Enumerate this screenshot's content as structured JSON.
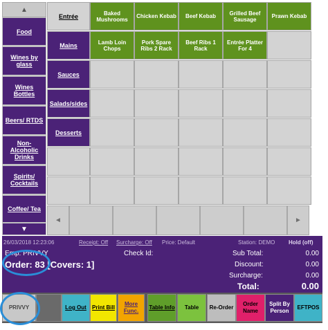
{
  "categories": {
    "scroll_up": "▲",
    "scroll_down": "▼",
    "items": [
      "Food",
      "Wines by glass",
      "Wines Bottles",
      "Beers/ RTDS",
      "Non-Alcoholic Drinks",
      "Spirits/ Cocktails",
      "Coffee/ Tea"
    ]
  },
  "subcategories": [
    "Entrée",
    "Mains",
    "Sauces",
    "Salads/sides",
    "Desserts",
    "",
    ""
  ],
  "menu_items": [
    "Baked Mushrooms",
    "Chicken Kebab",
    "Beef Kebab",
    "Grilled Beef Sausage",
    "Prawn Kebab",
    "Lamb Loin Chops",
    "Pork Spare Ribs 2 Rack",
    "Beef Ribs 1 Rack",
    "Entrée Platter For 4"
  ],
  "grid_scroll": {
    "left": "◄",
    "right": "►"
  },
  "info": {
    "datetime": "26/03/2018 12:23:06",
    "receipt": "Receipt: Off",
    "surcharge_status": "Surcharge: Off",
    "price": "Price: Default",
    "station": "Station: DEMO",
    "hold": "Hold (off)",
    "emp": "Emp: PRIVVY",
    "check_id": "Check Id:",
    "order": "Order: 83 [Covers:  1]",
    "subtotal_label": "Sub Total:",
    "subtotal_value": "0.00",
    "discount_label": "Discount:",
    "discount_value": "0.00",
    "surcharge_label": "Surcharge:",
    "surcharge_value": "0.00",
    "total_label": "Total:",
    "total_value": "0.00"
  },
  "buttons": {
    "privvy": "PRIVVY",
    "logout": "Log Out",
    "print_bill": "Print Bill",
    "more_func": "More Func.",
    "table_info": "Table Info",
    "table": "Table",
    "reorder": "Re-Order",
    "order_name": "Order Name",
    "split_by_person": "Split By Person",
    "eftpos": "EFTPOS"
  },
  "colors": {
    "purple": "#4b2277",
    "item_green": "#5f921e",
    "highlight_circle": "#2a8ed8"
  }
}
